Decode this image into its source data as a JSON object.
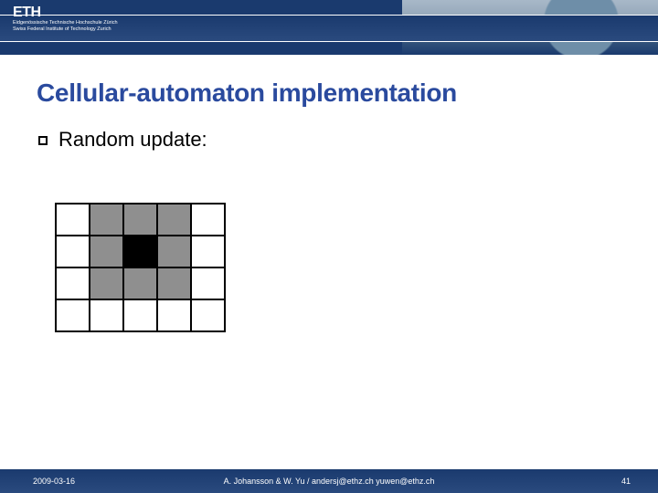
{
  "header": {
    "logo_main": "ETH",
    "logo_sub1": "Eidgenössische Technische Hochschule Zürich",
    "logo_sub2": "Swiss Federal Institute of Technology Zurich"
  },
  "title": "Cellular-automaton implementation",
  "bullet": "Random update:",
  "grid": {
    "rows": [
      [
        "white",
        "grey",
        "grey",
        "grey",
        "white"
      ],
      [
        "white",
        "grey",
        "black",
        "grey",
        "white"
      ],
      [
        "white",
        "grey",
        "grey",
        "grey",
        "white"
      ],
      [
        "white",
        "white",
        "white",
        "white",
        "white"
      ]
    ]
  },
  "footer": {
    "date": "2009-03-16",
    "authors": "A. Johansson & W. Yu / andersj@ethz.ch yuwen@ethz.ch",
    "page": "41"
  }
}
